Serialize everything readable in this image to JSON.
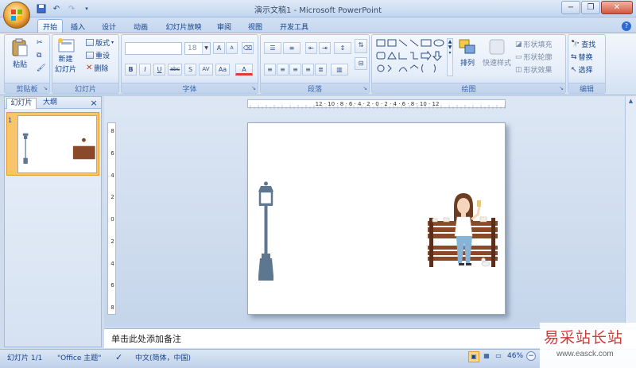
{
  "window": {
    "title": "演示文稿1 - Microsoft PowerPoint",
    "controls": [
      "minimize",
      "restore",
      "close"
    ]
  },
  "qat": {
    "icons": [
      "save-icon",
      "undo-icon",
      "redo-icon",
      "customize-icon"
    ]
  },
  "tabs": [
    "开始",
    "插入",
    "设计",
    "动画",
    "幻灯片放映",
    "审阅",
    "视图",
    "开发工具"
  ],
  "active_tab": "开始",
  "ribbon": {
    "clipboard": {
      "label": "剪贴板",
      "paste": "粘贴"
    },
    "slides": {
      "label": "幻灯片",
      "new_slide_1": "新建",
      "new_slide_2": "幻灯片",
      "layout": "版式",
      "reset": "重设",
      "delete": "删除"
    },
    "font": {
      "label": "字体",
      "font_name": "",
      "font_size": "18",
      "grow": "A",
      "shrink": "A",
      "bold": "B",
      "italic": "I",
      "underline": "U",
      "strike": "abc",
      "shadow": "S",
      "spacing": "AV",
      "case": "Aa",
      "color": "A"
    },
    "paragraph": {
      "label": "段落"
    },
    "drawing": {
      "label": "绘图",
      "arrange": "排列",
      "quick_styles": "快速样式",
      "shape_fill": "形状填充",
      "shape_outline": "形状轮廓",
      "shape_effects": "形状效果"
    },
    "editing": {
      "label": "编辑",
      "find": "查找",
      "replace": "替换",
      "select": "选择"
    }
  },
  "left_panel": {
    "tab_slides": "幻灯片",
    "tab_outline": "大纲",
    "slide_number": "1"
  },
  "ruler": {
    "horizontal": "12 · 10 · 8 · 6 · 4 · 2 · 0 · 2 · 4 · 6 · 8 · 10 · 12",
    "vertical": [
      "8",
      "6",
      "4",
      "2",
      "0",
      "2",
      "4",
      "6",
      "8"
    ]
  },
  "notes": {
    "placeholder": "单击此处添加备注"
  },
  "status": {
    "slide_counter": "幻灯片 1/1",
    "theme": "\"Office 主题\"",
    "language": "中文(简体，中国)",
    "zoom": "46%"
  },
  "watermark": {
    "text": "易采站长站",
    "url": "www.easck.com"
  },
  "colors": {
    "lamp": "#5e7790",
    "bench_wood": "#8a4a2a",
    "accent": "#15428b"
  }
}
